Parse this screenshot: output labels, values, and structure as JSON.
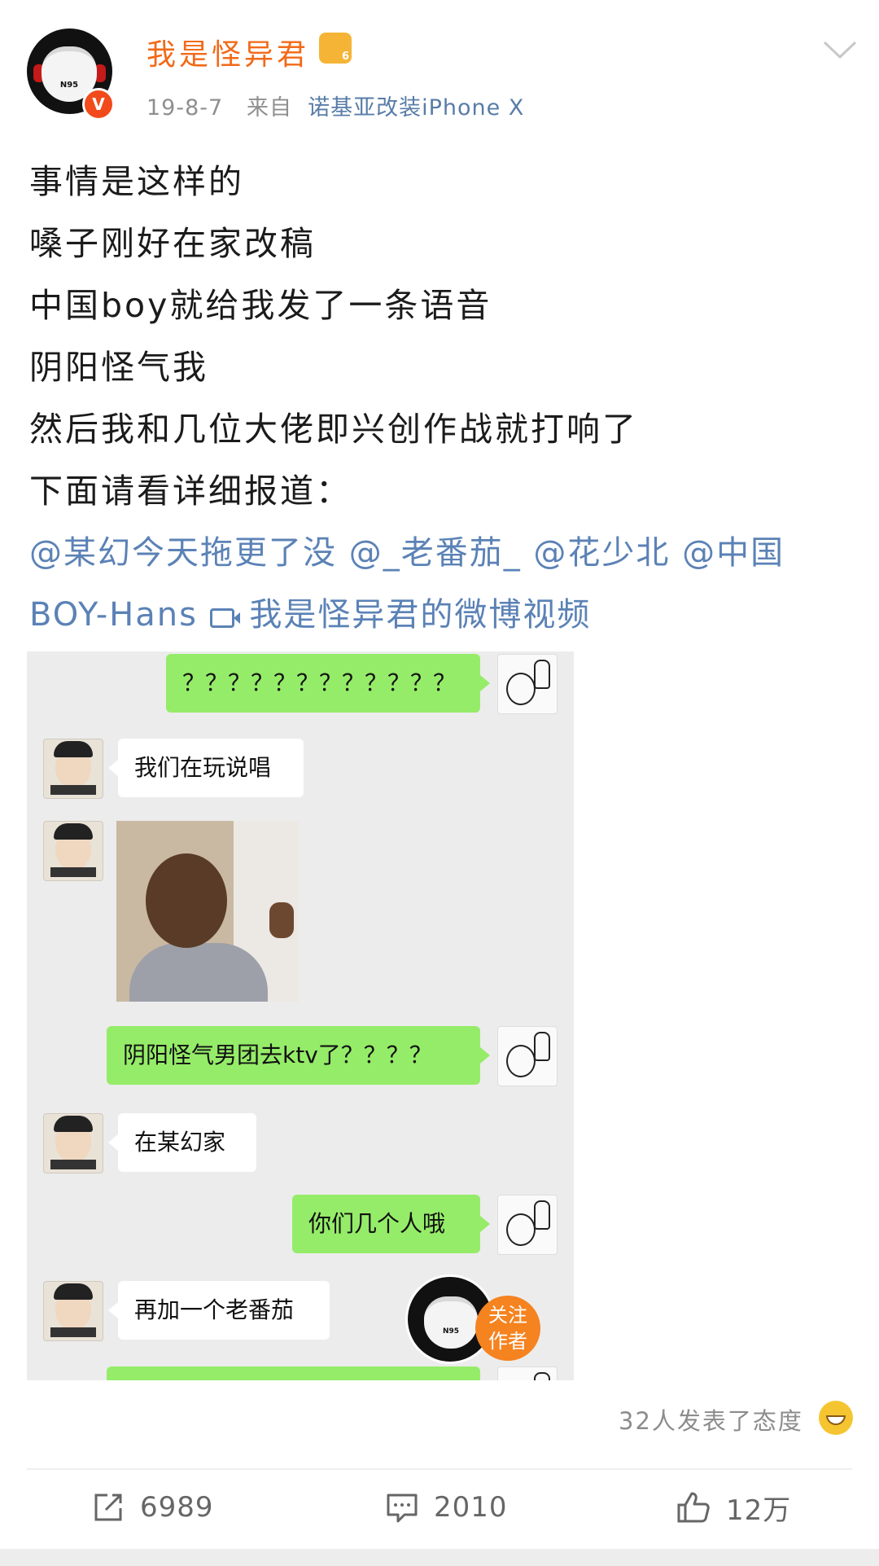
{
  "header": {
    "username": "我是怪异君",
    "level_badge": "6",
    "date": "19-8-7",
    "from_label": "来自",
    "source": "诺基亚改装iPhone X",
    "avatar_text": "N95",
    "verified_badge": "V"
  },
  "post": {
    "lines": [
      "事情是这样的",
      "嗓子刚好在家改稿",
      "中国boy就给我发了一条语音",
      "阴阳怪气我",
      "然后我和几位大佬即兴创作战就打响了",
      "下面请看详细报道："
    ],
    "mention_line1": "@某幻今天拖更了没 @_老番茄_ @花少北 @中国",
    "mention_line2_prefix": "BOY-Hans ",
    "video_link": "我是怪异君的微博视频"
  },
  "chat": {
    "messages": [
      {
        "side": "right",
        "text": "？？？？？？？？？？？？"
      },
      {
        "side": "left",
        "text": "我们在玩说唱"
      },
      {
        "side": "left",
        "type": "image"
      },
      {
        "side": "right",
        "text": "阴阳怪气男团去ktv了？？？？"
      },
      {
        "side": "left",
        "text": "在某幻家"
      },
      {
        "side": "right",
        "text": "你们几个人哦"
      },
      {
        "side": "left",
        "text": "再加一个老番茄"
      }
    ]
  },
  "follow": {
    "label_line1": "关注",
    "label_line2": "作者"
  },
  "reactions": {
    "text": "32人发表了态度"
  },
  "actions": {
    "repost_count": "6989",
    "comment_count": "2010",
    "like_count": "12万"
  },
  "colors": {
    "username": "#f26a19",
    "link": "#5b82b6",
    "green_bubble": "#95ec69",
    "follow_button": "#f58320"
  }
}
